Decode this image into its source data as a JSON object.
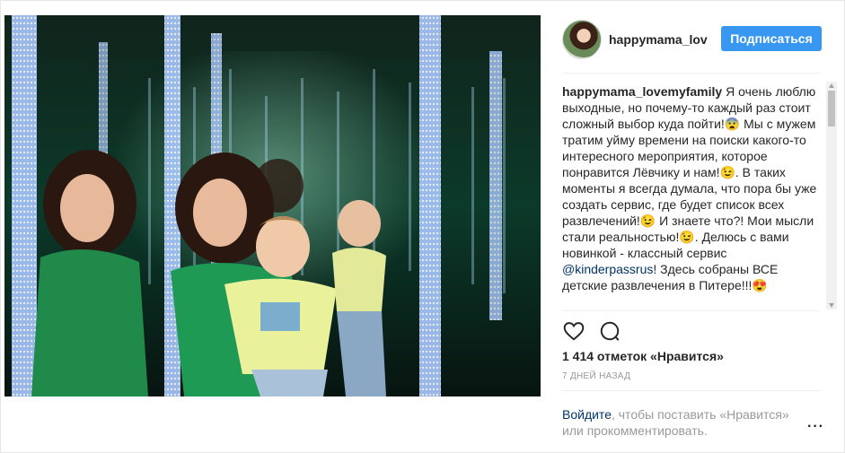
{
  "post": {
    "photo_icon": "post-photo",
    "author": {
      "username": "happymama_lovemyfamily",
      "username_display": "happymama_lov",
      "avatar_icon": "avatar-photo"
    },
    "follow_label": "Подписаться",
    "caption": {
      "username": "happymama_lovemyfamily",
      "part1": " Я очень люблю выходные, но почему-то каждый раз стоит сложный выбор куда пойти!😨 Мы с мужем тратим уйму времени на поиски какого-то интересного мероприятия, которое понравится Лёвчику и нам!😉. В таких моменты я всегда думала, что пора бы уже создать сервис, где будет список всех развлечений!😉 И знаете что?! Мои мысли стали реальностью!😉. Делюсь с вами новинкой - классный сервис ",
      "mention": "@kinderpassrus",
      "part2": "! Здесь собраны ВСЕ детские развлечения в Питере!!!😍"
    },
    "actions": {
      "like_icon": "heart-icon",
      "comment_icon": "comment-icon"
    },
    "likes_text": "1 414 отметок «Нравится»",
    "time_text": "7 ДНЕЙ НАЗАД",
    "login_prompt": {
      "link": "Войдите",
      "text": ", чтобы поставить «Нравится» или прокомментировать."
    },
    "more_label": "···"
  },
  "colors": {
    "accent": "#3897f0",
    "link": "#003569",
    "muted": "#999999"
  }
}
